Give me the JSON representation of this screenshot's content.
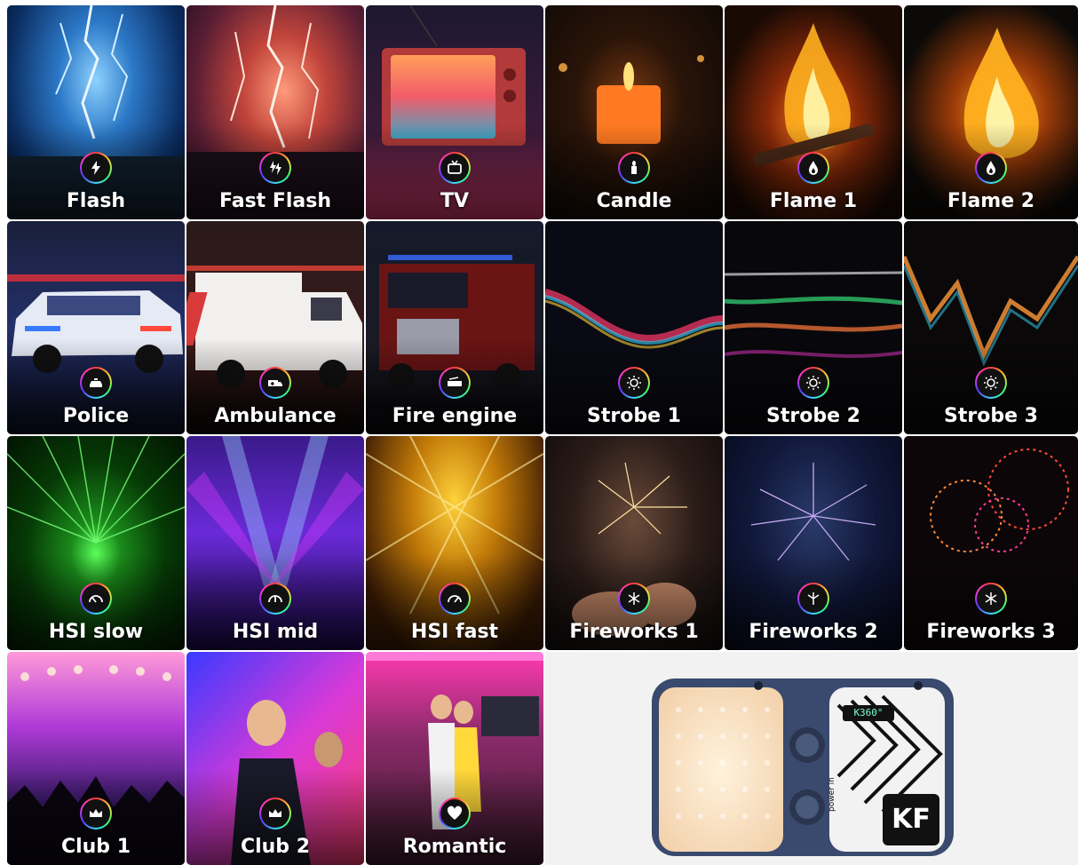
{
  "tiles": [
    {
      "label": "Flash",
      "icon": "lightning-icon"
    },
    {
      "label": "Fast Flash",
      "icon": "double-lightning-icon"
    },
    {
      "label": "TV",
      "icon": "tv-icon"
    },
    {
      "label": "Candle",
      "icon": "candle-icon"
    },
    {
      "label": "Flame 1",
      "icon": "flame-icon"
    },
    {
      "label": "Flame 2",
      "icon": "flame-icon"
    },
    {
      "label": "Police",
      "icon": "police-car-icon"
    },
    {
      "label": "Ambulance",
      "icon": "ambulance-icon"
    },
    {
      "label": "Fire engine",
      "icon": "fire-truck-icon"
    },
    {
      "label": "Strobe 1",
      "icon": "strobe-icon"
    },
    {
      "label": "Strobe 2",
      "icon": "strobe-icon"
    },
    {
      "label": "Strobe 3",
      "icon": "strobe-icon"
    },
    {
      "label": "HSI slow",
      "icon": "gauge-icon"
    },
    {
      "label": "HSI mid",
      "icon": "gauge-icon"
    },
    {
      "label": "HSI fast",
      "icon": "gauge-icon"
    },
    {
      "label": "Fireworks 1",
      "icon": "firework-icon"
    },
    {
      "label": "Fireworks 2",
      "icon": "firework-icon"
    },
    {
      "label": "Fireworks 3",
      "icon": "firework-icon"
    },
    {
      "label": "Club 1",
      "icon": "crown-icon"
    },
    {
      "label": "Club 2",
      "icon": "crown-icon"
    },
    {
      "label": "Romantic",
      "icon": "heart-icon"
    }
  ],
  "product": {
    "display_text": "K360°",
    "side_text": "power in",
    "logo": "KF"
  }
}
